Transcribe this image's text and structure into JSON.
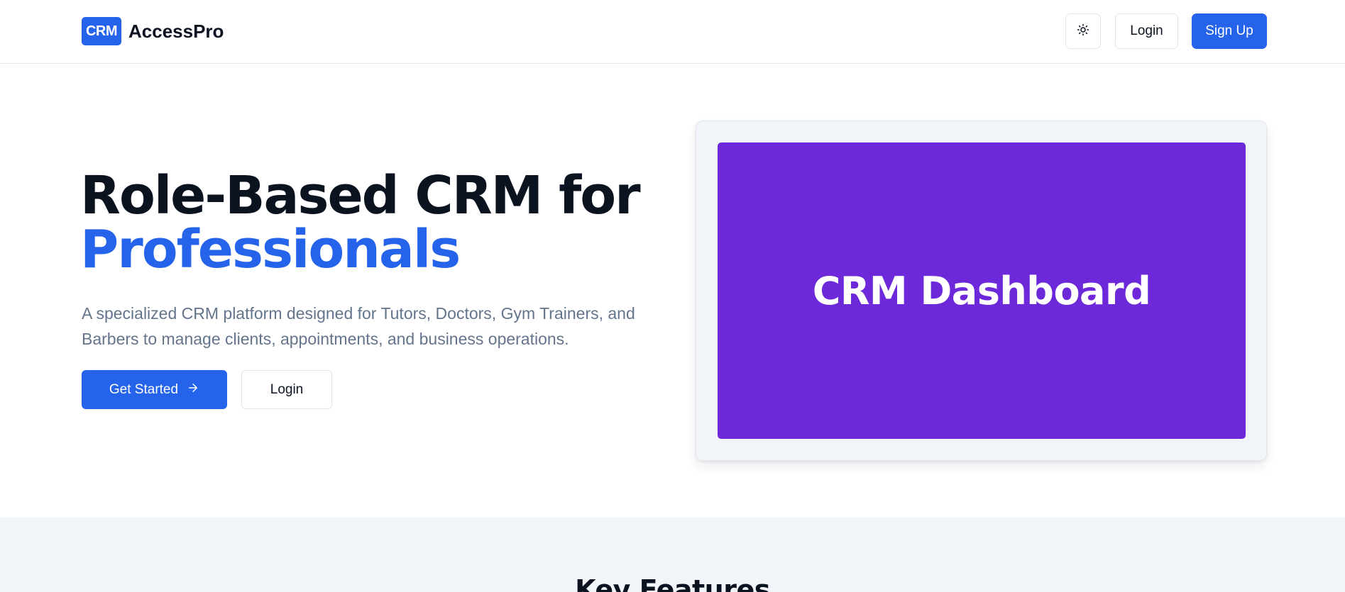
{
  "header": {
    "brand_badge": "CRM",
    "brand_name": "AccessPro",
    "theme_toggle_icon": "sun-icon",
    "login_label": "Login",
    "signup_label": "Sign Up"
  },
  "hero": {
    "title_line1": "Role-Based CRM for",
    "title_line2": "Professionals",
    "description": "A specialized CRM platform designed for Tutors, Doctors, Gym Trainers, and Barbers to manage clients, appointments, and business operations.",
    "primary_cta_label": "Get Started",
    "primary_cta_icon": "arrow-right-icon",
    "secondary_cta_label": "Login"
  },
  "preview": {
    "label": "CRM Dashboard"
  },
  "features": {
    "title": "Key Features"
  },
  "colors": {
    "primary": "#2563eb",
    "preview_bg": "#6d28d9",
    "text_dark": "#0b1220",
    "text_muted": "#64748b",
    "band_bg": "#f1f4f8"
  }
}
